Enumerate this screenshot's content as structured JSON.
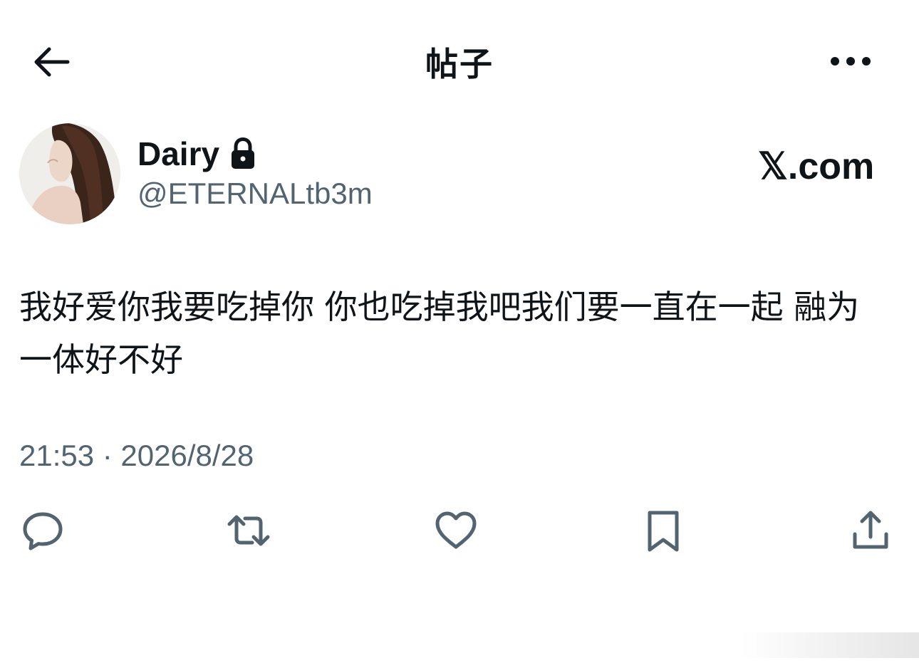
{
  "header": {
    "title": "帖子",
    "back_icon": "arrow-left-icon",
    "more_icon": "more-horizontal-icon"
  },
  "author": {
    "display_name": "Dairy",
    "handle": "@ETERNALtb3m",
    "protected_icon": "lock-icon"
  },
  "watermark": {
    "text": "𝕏.com"
  },
  "post": {
    "text": "我好爱你我要吃掉你 你也吃掉我吧我们要一直在一起 融为一体好不好",
    "timestamp": "21:53 · 2026/8/28"
  },
  "actions": [
    {
      "name": "reply",
      "icon": "reply-icon"
    },
    {
      "name": "repost",
      "icon": "repost-icon"
    },
    {
      "name": "like",
      "icon": "heart-icon"
    },
    {
      "name": "bookmark",
      "icon": "bookmark-icon"
    },
    {
      "name": "share",
      "icon": "share-icon"
    }
  ],
  "colors": {
    "text_primary": "#0f1419",
    "text_secondary": "#536471",
    "icon": "#536471"
  }
}
